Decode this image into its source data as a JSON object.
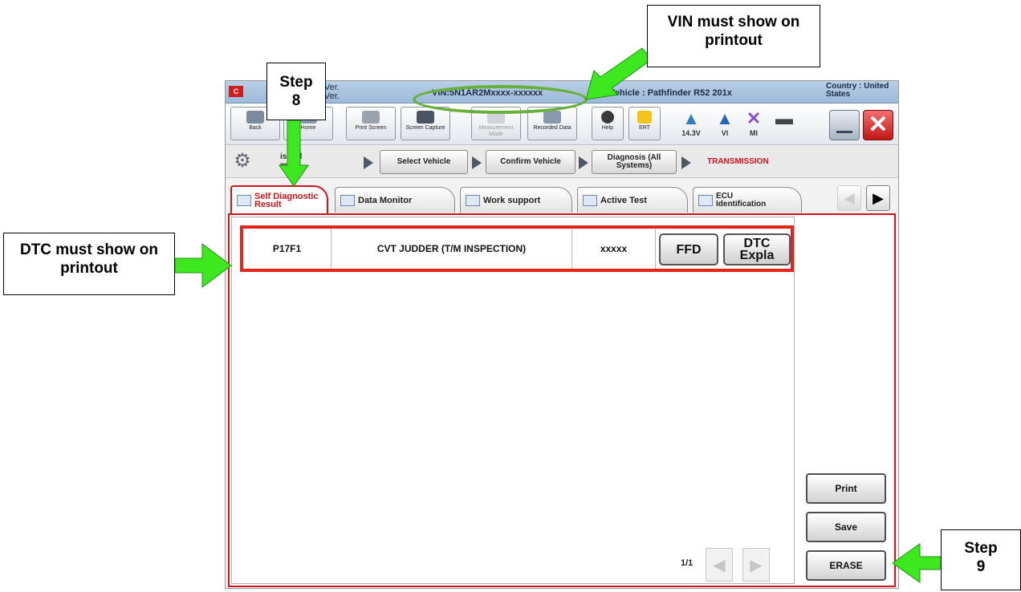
{
  "window": {
    "title_fragment": "s",
    "version_label_1": "Ver.",
    "version_label_2": "Ver.",
    "vin": "VIN:5N1AR2Mxxxx-xxxxxx",
    "vehicle": "Vehicle : Pathfinder R52 201x",
    "country": "Country : United States"
  },
  "toolbar": {
    "buttons": [
      {
        "label": "Back",
        "icon": "back-arrow-icon"
      },
      {
        "label": "Home",
        "icon": "home-icon"
      },
      {
        "label": "Print Screen",
        "icon": "printer-icon"
      },
      {
        "label": "Screen Capture",
        "icon": "camera-icon"
      },
      {
        "label": "Measurement Mode",
        "icon": "measurement-icon"
      },
      {
        "label": "Recorded Data",
        "icon": "recorded-data-icon"
      },
      {
        "label": "Help",
        "icon": "help-icon"
      },
      {
        "label": "ERT",
        "icon": "warning-icon"
      }
    ],
    "status": [
      {
        "label": "14.3V",
        "icon": "car-battery-icon"
      },
      {
        "label": "VI",
        "icon": "signal-icon"
      },
      {
        "label": "MI",
        "icon": "mi-cross-icon"
      },
      {
        "label": "",
        "icon": "battery-icon"
      }
    ]
  },
  "breadcrumb": {
    "first": "is (All\nms)",
    "items": [
      "Select Vehicle",
      "Confirm Vehicle",
      "Diagnosis (All Systems)"
    ],
    "current": "TRANSMISSION"
  },
  "tabs": [
    {
      "label": "Self Diagnostic Result",
      "active": true
    },
    {
      "label": "Data Monitor",
      "active": false
    },
    {
      "label": "Work support",
      "active": false
    },
    {
      "label": "Active Test",
      "active": false
    },
    {
      "label": "ECU Identification",
      "active": false
    }
  ],
  "dtc": {
    "code": "P17F1",
    "description": "CVT JUDDER (T/M INSPECTION)",
    "count": "xxxxx",
    "ffd_label": "FFD",
    "expla_label_1": "DTC",
    "expla_label_2": "Expla"
  },
  "pager": {
    "text": "1/1"
  },
  "actions": {
    "print": "Print",
    "save": "Save",
    "erase": "ERASE"
  },
  "annotations": {
    "step8_line1": "Step",
    "step8_line2": "8",
    "vin_line1": "VIN must show on",
    "vin_line2": "printout",
    "dtc_line1": "DTC must show on",
    "dtc_line2": "printout",
    "step9_line1": "Step",
    "step9_line2": "9",
    "arrow_color": "#3ee81f"
  }
}
